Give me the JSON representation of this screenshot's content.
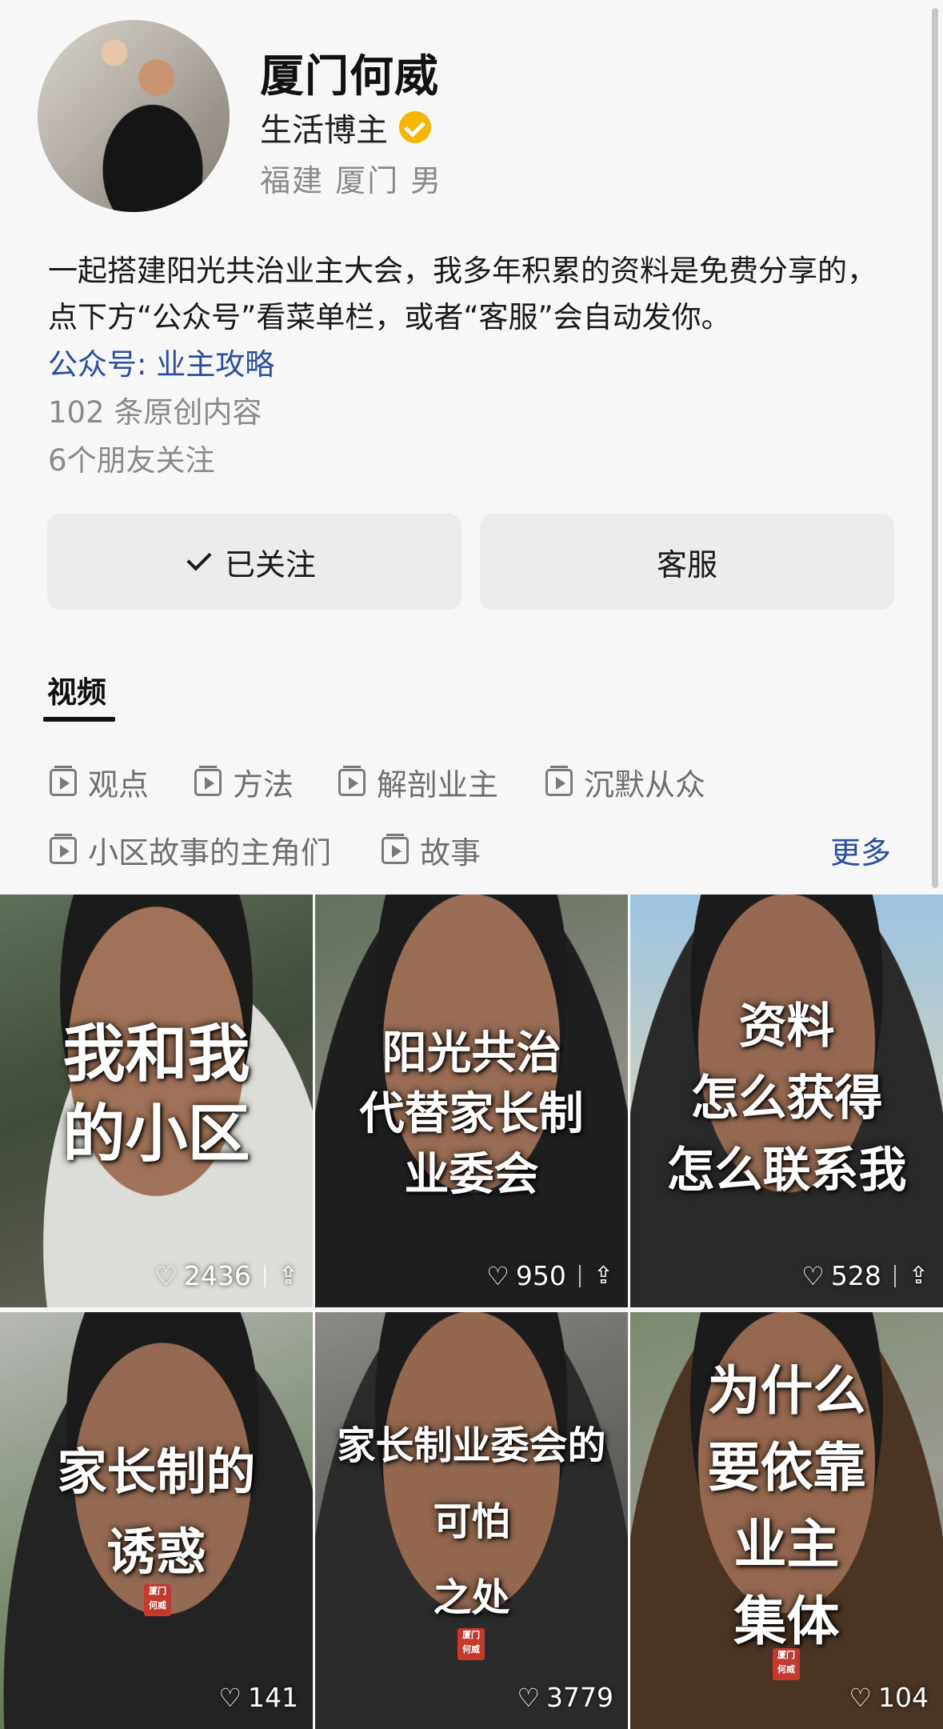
{
  "profile": {
    "name": "厦门何威",
    "role": "生活博主",
    "location": "福建 厦门 男",
    "bio": "一起搭建阳光共治业主大会，我多年积累的资料是免费分享的，点下方“公众号”看菜单栏，或者“客服”会自动发你。",
    "official_account": "公众号: 业主攻略",
    "original_count": "102 条原创内容",
    "friends_following": "6个朋友关注"
  },
  "actions": {
    "follow_label": "已关注",
    "service_label": "客服"
  },
  "tabs": {
    "video": "视频"
  },
  "collections": {
    "items": [
      "观点",
      "方法",
      "解剖业主",
      "沉默从众",
      "小区故事的主角们",
      "故事"
    ],
    "more": "更多"
  },
  "videos": [
    {
      "caption": "我和我\n的小区",
      "likes": "2436",
      "pinned": true
    },
    {
      "caption": "阳光共治\n代替家长制\n业委会",
      "likes": "950",
      "pinned": true
    },
    {
      "caption": "资料\n怎么获得\n怎么联系我",
      "likes": "528",
      "pinned": true
    },
    {
      "caption": "家长制的\n诱惑",
      "likes": "141",
      "pinned": false,
      "stamp": "厦门何威"
    },
    {
      "caption": "家长制业委会的\n可怕\n之处",
      "likes": "3779",
      "pinned": false,
      "stamp": "厦门何威"
    },
    {
      "caption": "为什么\n要依靠\n业主\n集体",
      "likes": "104",
      "pinned": false,
      "stamp": "厦门何威"
    }
  ],
  "colors": {
    "accent_link": "#2a4fa0",
    "verified_badge": "#f7b500",
    "muted_text": "#8a8a8a",
    "button_bg": "#ececec"
  }
}
